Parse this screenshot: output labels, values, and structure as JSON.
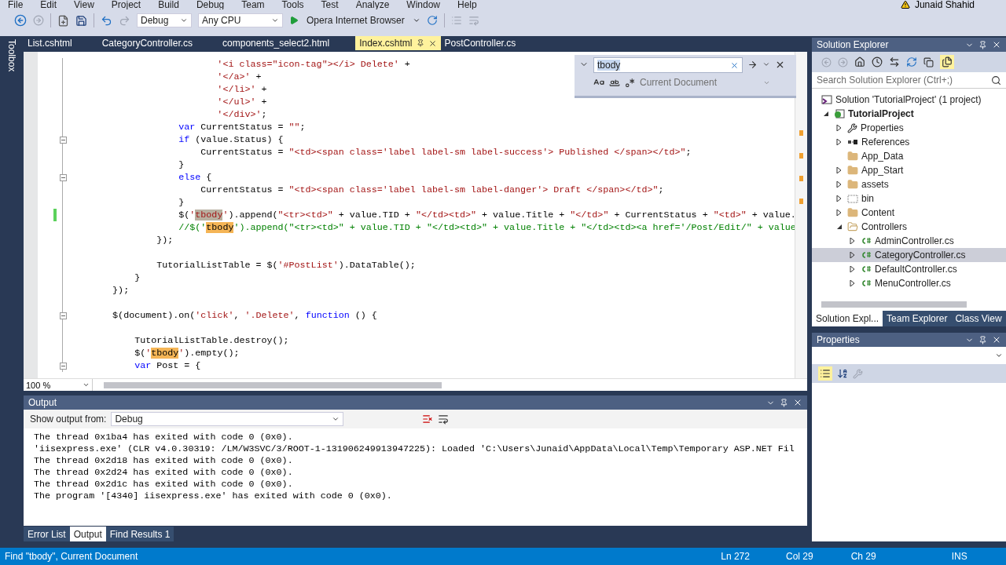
{
  "menu": [
    "File",
    "Edit",
    "View",
    "Project",
    "Build",
    "Debug",
    "Team",
    "Tools",
    "Test",
    "Analyze",
    "Window",
    "Help"
  ],
  "account": {
    "name": "Junaid Shahid"
  },
  "toolbar": {
    "configuration": "Debug",
    "platform": "Any CPU",
    "run_target": "Opera Internet Browser"
  },
  "toolbox_label": "Toolbox",
  "editor_tabs": [
    {
      "label": "List.cshtml",
      "selected": false
    },
    {
      "label": "CategoryController.cs",
      "selected": false
    },
    {
      "label": "components_select2.html",
      "selected": false
    },
    {
      "label": "Index.cshtml",
      "selected": true
    },
    {
      "label": "PostController.cs",
      "selected": false
    }
  ],
  "code_lines": [
    {
      "fold": false,
      "changed": false,
      "segments": [
        {
          "kind": "string",
          "text": "                           '<i class=\"icon-tag\"></i> Delete'"
        },
        {
          "kind": "plain",
          "text": " +"
        }
      ]
    },
    {
      "fold": false,
      "changed": false,
      "segments": [
        {
          "kind": "string",
          "text": "                           '</a>'"
        },
        {
          "kind": "plain",
          "text": " +"
        }
      ]
    },
    {
      "fold": false,
      "changed": false,
      "segments": [
        {
          "kind": "string",
          "text": "                           '</li>'"
        },
        {
          "kind": "plain",
          "text": " +"
        }
      ]
    },
    {
      "fold": false,
      "changed": false,
      "segments": [
        {
          "kind": "string",
          "text": "                           '</ul>'"
        },
        {
          "kind": "plain",
          "text": " +"
        }
      ]
    },
    {
      "fold": false,
      "changed": false,
      "segments": [
        {
          "kind": "string",
          "text": "                           '</div>'"
        },
        {
          "kind": "plain",
          "text": ";"
        }
      ]
    },
    {
      "fold": false,
      "changed": false,
      "segments": [
        {
          "kind": "keyword",
          "text": "                    var"
        },
        {
          "kind": "plain",
          "text": " CurrentStatus = "
        },
        {
          "kind": "string",
          "text": "\"\""
        },
        {
          "kind": "plain",
          "text": ";"
        }
      ]
    },
    {
      "fold": true,
      "changed": false,
      "segments": [
        {
          "kind": "keyword",
          "text": "                    if"
        },
        {
          "kind": "plain",
          "text": " (value.Status) {"
        }
      ]
    },
    {
      "fold": false,
      "changed": false,
      "segments": [
        {
          "kind": "plain",
          "text": "                        CurrentStatus = "
        },
        {
          "kind": "string",
          "text": "\"<td><span class='label label-sm label-success'> Published </span></td>\""
        },
        {
          "kind": "plain",
          "text": ";"
        }
      ]
    },
    {
      "fold": false,
      "changed": false,
      "segments": [
        {
          "kind": "plain",
          "text": "                    }"
        }
      ]
    },
    {
      "fold": true,
      "changed": false,
      "segments": [
        {
          "kind": "keyword",
          "text": "                    else"
        },
        {
          "kind": "plain",
          "text": " {"
        }
      ]
    },
    {
      "fold": false,
      "changed": false,
      "segments": [
        {
          "kind": "plain",
          "text": "                        CurrentStatus = "
        },
        {
          "kind": "string",
          "text": "\"<td><span class='label label-sm label-danger'> Draft </span></td>\""
        },
        {
          "kind": "plain",
          "text": ";"
        }
      ]
    },
    {
      "fold": false,
      "changed": false,
      "segments": [
        {
          "kind": "plain",
          "text": "                    }"
        }
      ]
    },
    {
      "fold": false,
      "changed": true,
      "segments": [
        {
          "kind": "plain",
          "text": "                    $("
        },
        {
          "kind": "string",
          "text": "'"
        },
        {
          "kind": "current-match",
          "text": "tbody"
        },
        {
          "kind": "string",
          "text": "'"
        },
        {
          "kind": "plain",
          "text": ").append("
        },
        {
          "kind": "string",
          "text": "\"<tr><td>\""
        },
        {
          "kind": "plain",
          "text": " + value.TID + "
        },
        {
          "kind": "string",
          "text": "\"</td><td>\""
        },
        {
          "kind": "plain",
          "text": " + value.Title + "
        },
        {
          "kind": "string",
          "text": "\"</td>\""
        },
        {
          "kind": "plain",
          "text": " + CurrentStatus + "
        },
        {
          "kind": "string",
          "text": "\"<td>\""
        },
        {
          "kind": "plain",
          "text": " + value."
        }
      ]
    },
    {
      "fold": false,
      "changed": false,
      "segments": [
        {
          "kind": "comment",
          "text": "                    //$('"
        },
        {
          "kind": "match",
          "text": "tbody"
        },
        {
          "kind": "comment",
          "text": "').append(\"<tr><td>\" + value.TID + \"</td><td>\" + value.Title + \"</td><td><a href='/Post/Edit/\" + value"
        }
      ]
    },
    {
      "fold": false,
      "changed": false,
      "segments": [
        {
          "kind": "plain",
          "text": "                });"
        }
      ]
    },
    {
      "fold": false,
      "changed": false
    },
    {
      "fold": false,
      "changed": false,
      "segments": [
        {
          "kind": "plain",
          "text": "                TutorialListTable = $("
        },
        {
          "kind": "string",
          "text": "'#PostList'"
        },
        {
          "kind": "plain",
          "text": ").DataTable();"
        }
      ]
    },
    {
      "fold": false,
      "changed": false,
      "segments": [
        {
          "kind": "plain",
          "text": "            }"
        }
      ]
    },
    {
      "fold": false,
      "changed": false,
      "segments": [
        {
          "kind": "plain",
          "text": "        });"
        }
      ]
    },
    {
      "fold": false,
      "changed": false
    },
    {
      "fold": true,
      "changed": false,
      "segments": [
        {
          "kind": "plain",
          "text": "        $(document).on("
        },
        {
          "kind": "string",
          "text": "'click'"
        },
        {
          "kind": "plain",
          "text": ", "
        },
        {
          "kind": "string",
          "text": "'.Delete'"
        },
        {
          "kind": "plain",
          "text": ", "
        },
        {
          "kind": "keyword",
          "text": "function"
        },
        {
          "kind": "plain",
          "text": " () {"
        }
      ]
    },
    {
      "fold": false,
      "changed": false
    },
    {
      "fold": false,
      "changed": false,
      "segments": [
        {
          "kind": "plain",
          "text": "            TutorialListTable.destroy();"
        }
      ]
    },
    {
      "fold": false,
      "changed": false,
      "segments": [
        {
          "kind": "plain",
          "text": "            $("
        },
        {
          "kind": "string",
          "text": "'"
        },
        {
          "kind": "match",
          "text": "tbody"
        },
        {
          "kind": "string",
          "text": "'"
        },
        {
          "kind": "plain",
          "text": ").empty();"
        }
      ]
    },
    {
      "fold": true,
      "changed": false,
      "segments": [
        {
          "kind": "keyword",
          "text": "            var"
        },
        {
          "kind": "plain",
          "text": " Post = {"
        }
      ]
    }
  ],
  "find": {
    "query": "tbody",
    "scope": "Current Document"
  },
  "zoom": "100 %",
  "solution_explorer": {
    "title": "Solution Explorer",
    "search_placeholder": "Search Solution Explorer (Ctrl+;)",
    "tree": [
      {
        "label": "Solution 'TutorialProject' (1 project)",
        "kind": "solution",
        "selected": false,
        "children": [
          {
            "label": "TutorialProject",
            "kind": "project",
            "expanded": true,
            "selected": false,
            "children": [
              {
                "label": "Properties",
                "kind": "wrench",
                "expanded": false,
                "selected": false
              },
              {
                "label": "References",
                "kind": "references",
                "expanded": false,
                "selected": false
              },
              {
                "label": "App_Data",
                "kind": "folder",
                "selected": false
              },
              {
                "label": "App_Start",
                "kind": "folder",
                "expanded": false,
                "selected": false
              },
              {
                "label": "assets",
                "kind": "folder",
                "expanded": false,
                "selected": false
              },
              {
                "label": "bin",
                "kind": "hidden-folder",
                "expanded": false,
                "selected": false
              },
              {
                "label": "Content",
                "kind": "folder",
                "expanded": false,
                "selected": false
              },
              {
                "label": "Controllers",
                "kind": "folder",
                "expanded": true,
                "selected": false,
                "children": [
                  {
                    "label": "AdminController.cs",
                    "kind": "csharp",
                    "expanded": false,
                    "selected": false
                  },
                  {
                    "label": "CategoryController.cs",
                    "kind": "csharp",
                    "expanded": false,
                    "selected": true
                  },
                  {
                    "label": "DefaultController.cs",
                    "kind": "csharp",
                    "expanded": false,
                    "selected": false
                  },
                  {
                    "label": "MenuController.cs",
                    "kind": "csharp",
                    "expanded": false,
                    "selected": false
                  }
                ]
              }
            ]
          }
        ]
      }
    ],
    "tabs": [
      {
        "label": "Solution Expl...",
        "selected": true
      },
      {
        "label": "Team Explorer",
        "selected": false
      },
      {
        "label": "Class View",
        "selected": false
      }
    ]
  },
  "properties": {
    "title": "Properties"
  },
  "output": {
    "title": "Output",
    "source_label": "Show output from:",
    "source": "Debug",
    "lines": [
      "The thread 0x1ba4 has exited with code 0 (0x0).",
      "'iisexpress.exe' (CLR v4.0.30319: /LM/W3SVC/3/ROOT-1-131906249913947225): Loaded 'C:\\Users\\Junaid\\AppData\\Local\\Temp\\Temporary ASP.NET Fil",
      "The thread 0x2d18 has exited with code 0 (0x0).",
      "The thread 0x2d24 has exited with code 0 (0x0).",
      "The thread 0x2d1c has exited with code 0 (0x0).",
      "The program '[4340] iisexpress.exe' has exited with code 0 (0x0)."
    ]
  },
  "bottom_tabs": [
    {
      "label": "Error List",
      "selected": false
    },
    {
      "label": "Output",
      "selected": true
    },
    {
      "label": "Find Results 1",
      "selected": false
    }
  ],
  "status_bar": {
    "message": "Find \"tbody\", Current Document",
    "line": "Ln 272",
    "column": "Col 29",
    "char": "Ch 29",
    "mode": "INS"
  }
}
